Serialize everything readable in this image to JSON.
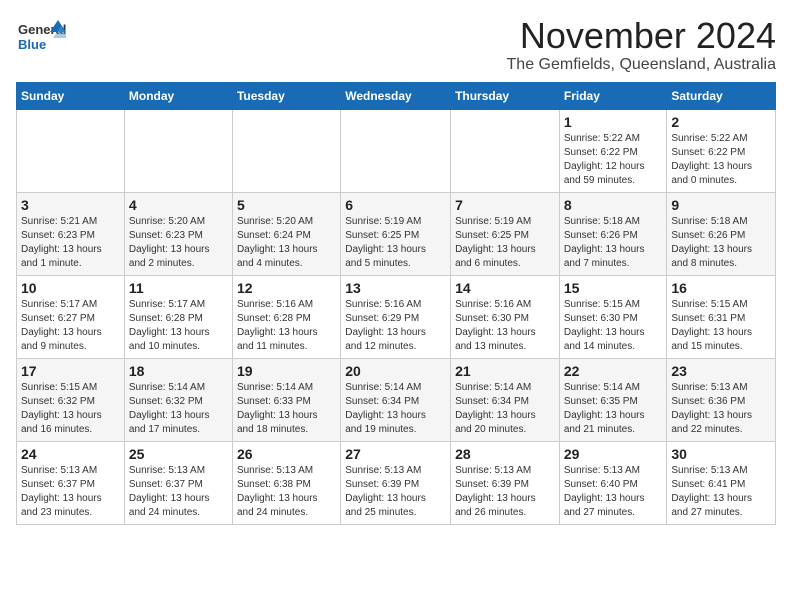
{
  "logo": {
    "general": "General",
    "blue": "Blue"
  },
  "title": {
    "month": "November 2024",
    "location": "The Gemfields, Queensland, Australia"
  },
  "headers": [
    "Sunday",
    "Monday",
    "Tuesday",
    "Wednesday",
    "Thursday",
    "Friday",
    "Saturday"
  ],
  "rows": [
    [
      {
        "day": "",
        "info": ""
      },
      {
        "day": "",
        "info": ""
      },
      {
        "day": "",
        "info": ""
      },
      {
        "day": "",
        "info": ""
      },
      {
        "day": "",
        "info": ""
      },
      {
        "day": "1",
        "info": "Sunrise: 5:22 AM\nSunset: 6:22 PM\nDaylight: 12 hours\nand 59 minutes."
      },
      {
        "day": "2",
        "info": "Sunrise: 5:22 AM\nSunset: 6:22 PM\nDaylight: 13 hours\nand 0 minutes."
      }
    ],
    [
      {
        "day": "3",
        "info": "Sunrise: 5:21 AM\nSunset: 6:23 PM\nDaylight: 13 hours\nand 1 minute."
      },
      {
        "day": "4",
        "info": "Sunrise: 5:20 AM\nSunset: 6:23 PM\nDaylight: 13 hours\nand 2 minutes."
      },
      {
        "day": "5",
        "info": "Sunrise: 5:20 AM\nSunset: 6:24 PM\nDaylight: 13 hours\nand 4 minutes."
      },
      {
        "day": "6",
        "info": "Sunrise: 5:19 AM\nSunset: 6:25 PM\nDaylight: 13 hours\nand 5 minutes."
      },
      {
        "day": "7",
        "info": "Sunrise: 5:19 AM\nSunset: 6:25 PM\nDaylight: 13 hours\nand 6 minutes."
      },
      {
        "day": "8",
        "info": "Sunrise: 5:18 AM\nSunset: 6:26 PM\nDaylight: 13 hours\nand 7 minutes."
      },
      {
        "day": "9",
        "info": "Sunrise: 5:18 AM\nSunset: 6:26 PM\nDaylight: 13 hours\nand 8 minutes."
      }
    ],
    [
      {
        "day": "10",
        "info": "Sunrise: 5:17 AM\nSunset: 6:27 PM\nDaylight: 13 hours\nand 9 minutes."
      },
      {
        "day": "11",
        "info": "Sunrise: 5:17 AM\nSunset: 6:28 PM\nDaylight: 13 hours\nand 10 minutes."
      },
      {
        "day": "12",
        "info": "Sunrise: 5:16 AM\nSunset: 6:28 PM\nDaylight: 13 hours\nand 11 minutes."
      },
      {
        "day": "13",
        "info": "Sunrise: 5:16 AM\nSunset: 6:29 PM\nDaylight: 13 hours\nand 12 minutes."
      },
      {
        "day": "14",
        "info": "Sunrise: 5:16 AM\nSunset: 6:30 PM\nDaylight: 13 hours\nand 13 minutes."
      },
      {
        "day": "15",
        "info": "Sunrise: 5:15 AM\nSunset: 6:30 PM\nDaylight: 13 hours\nand 14 minutes."
      },
      {
        "day": "16",
        "info": "Sunrise: 5:15 AM\nSunset: 6:31 PM\nDaylight: 13 hours\nand 15 minutes."
      }
    ],
    [
      {
        "day": "17",
        "info": "Sunrise: 5:15 AM\nSunset: 6:32 PM\nDaylight: 13 hours\nand 16 minutes."
      },
      {
        "day": "18",
        "info": "Sunrise: 5:14 AM\nSunset: 6:32 PM\nDaylight: 13 hours\nand 17 minutes."
      },
      {
        "day": "19",
        "info": "Sunrise: 5:14 AM\nSunset: 6:33 PM\nDaylight: 13 hours\nand 18 minutes."
      },
      {
        "day": "20",
        "info": "Sunrise: 5:14 AM\nSunset: 6:34 PM\nDaylight: 13 hours\nand 19 minutes."
      },
      {
        "day": "21",
        "info": "Sunrise: 5:14 AM\nSunset: 6:34 PM\nDaylight: 13 hours\nand 20 minutes."
      },
      {
        "day": "22",
        "info": "Sunrise: 5:14 AM\nSunset: 6:35 PM\nDaylight: 13 hours\nand 21 minutes."
      },
      {
        "day": "23",
        "info": "Sunrise: 5:13 AM\nSunset: 6:36 PM\nDaylight: 13 hours\nand 22 minutes."
      }
    ],
    [
      {
        "day": "24",
        "info": "Sunrise: 5:13 AM\nSunset: 6:37 PM\nDaylight: 13 hours\nand 23 minutes."
      },
      {
        "day": "25",
        "info": "Sunrise: 5:13 AM\nSunset: 6:37 PM\nDaylight: 13 hours\nand 24 minutes."
      },
      {
        "day": "26",
        "info": "Sunrise: 5:13 AM\nSunset: 6:38 PM\nDaylight: 13 hours\nand 24 minutes."
      },
      {
        "day": "27",
        "info": "Sunrise: 5:13 AM\nSunset: 6:39 PM\nDaylight: 13 hours\nand 25 minutes."
      },
      {
        "day": "28",
        "info": "Sunrise: 5:13 AM\nSunset: 6:39 PM\nDaylight: 13 hours\nand 26 minutes."
      },
      {
        "day": "29",
        "info": "Sunrise: 5:13 AM\nSunset: 6:40 PM\nDaylight: 13 hours\nand 27 minutes."
      },
      {
        "day": "30",
        "info": "Sunrise: 5:13 AM\nSunset: 6:41 PM\nDaylight: 13 hours\nand 27 minutes."
      }
    ]
  ]
}
